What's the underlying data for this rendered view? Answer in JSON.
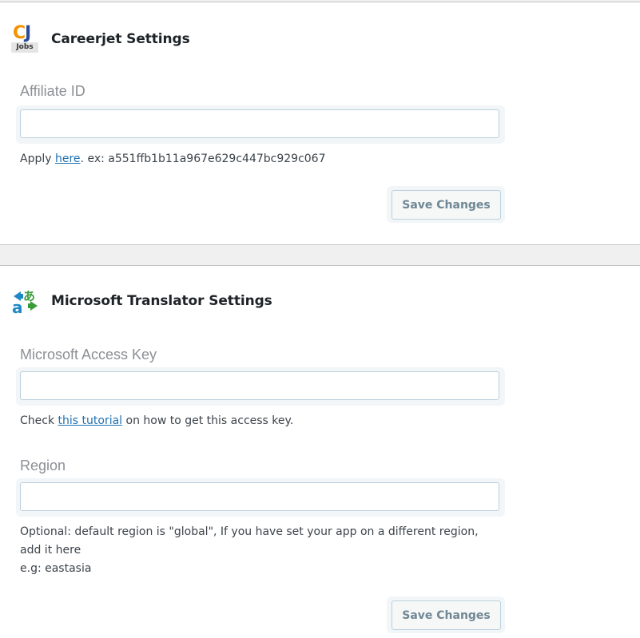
{
  "careerjet": {
    "title": "Careerjet Settings",
    "logo_text_c": "C",
    "logo_text_j": "J",
    "logo_text_jobs": "Jobs",
    "affiliate_label": "Affiliate ID",
    "affiliate_value": "",
    "help_prefix": "Apply ",
    "help_link": "here",
    "help_suffix": ". ex: a551ffb1b11a967e629c447bc929c067",
    "save_label": "Save Changes"
  },
  "translator": {
    "title": "Microsoft Translator Settings",
    "access_key_label": "Microsoft Access Key",
    "access_key_value": "",
    "access_help_prefix": "Check ",
    "access_help_link": "this tutorial",
    "access_help_suffix": " on how to get this access key.",
    "region_label": "Region",
    "region_value": "",
    "region_help_line1": "Optional: default region is \"global\", If you have set your app on a different region,",
    "region_help_line2": "add it here",
    "region_help_line3": "e.g: eastasia",
    "save_label": "Save Changes"
  },
  "colors": {
    "link": "#2271b1",
    "cj_orange": "#f39200",
    "cj_blue": "#2b4c9b",
    "translator_blue": "#1e88c7",
    "translator_green": "#3a9b3a"
  }
}
